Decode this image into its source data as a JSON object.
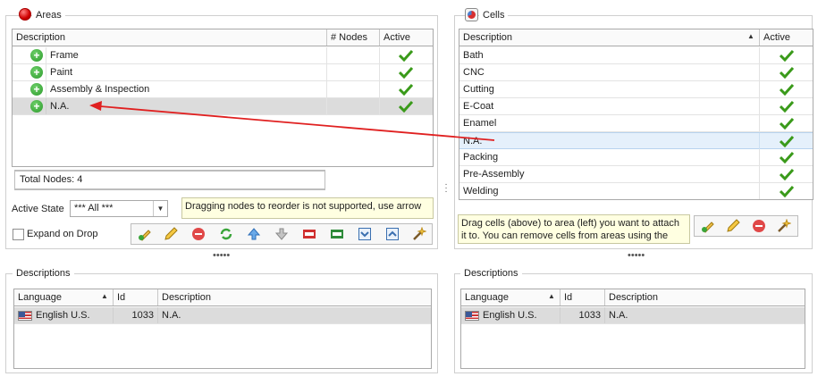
{
  "areas": {
    "title": "Areas",
    "columns": [
      "Description",
      "# Nodes",
      "Active"
    ],
    "rows": [
      {
        "description": "Frame"
      },
      {
        "description": "Paint"
      },
      {
        "description": "Assembly & Inspection"
      },
      {
        "description": "N.A."
      }
    ],
    "total_nodes": "Total Nodes: 4",
    "active_state_label": "Active State",
    "active_state_value": "*** All ***",
    "expand_on_drop_label": "Expand on Drop",
    "hint": "Dragging nodes to reorder is not supported, use arrow",
    "toolbar_icons": [
      "add-edit-icon",
      "pencil-icon",
      "delete-icon",
      "refresh-icon",
      "arrow-up-icon",
      "arrow-down-icon",
      "pdf-icon",
      "xlsx-icon",
      "expand-icon",
      "collapse-icon",
      "wand-icon"
    ]
  },
  "cells": {
    "title": "Cells",
    "columns": [
      "Description",
      "Active"
    ],
    "rows": [
      {
        "description": "Bath"
      },
      {
        "description": "CNC"
      },
      {
        "description": "Cutting"
      },
      {
        "description": "E-Coat"
      },
      {
        "description": "Enamel"
      },
      {
        "description": "N.A."
      },
      {
        "description": "Packing"
      },
      {
        "description": "Pre-Assembly"
      },
      {
        "description": "Welding"
      }
    ],
    "hint": "Drag cells (above) to area (left) you want to attach it to. You can remove cells from areas using the",
    "toolbar_icons": [
      "add-edit-icon",
      "pencil-icon",
      "delete-icon",
      "wand-icon"
    ]
  },
  "left_descriptions": {
    "title": "Descriptions",
    "columns": [
      "Language",
      "Id",
      "Description"
    ],
    "rows": [
      {
        "language": "English U.S.",
        "id": "1033",
        "description": "N.A."
      }
    ]
  },
  "right_descriptions": {
    "title": "Descriptions",
    "columns": [
      "Language",
      "Id",
      "Description"
    ],
    "rows": [
      {
        "language": "English U.S.",
        "id": "1033",
        "description": "N.A."
      }
    ]
  },
  "colors": {
    "selected_row": "#dcdcdc",
    "focused_row": "#e5f0fb",
    "drag_arrow": "#e02020",
    "hint_bg": "#ffffe1"
  }
}
